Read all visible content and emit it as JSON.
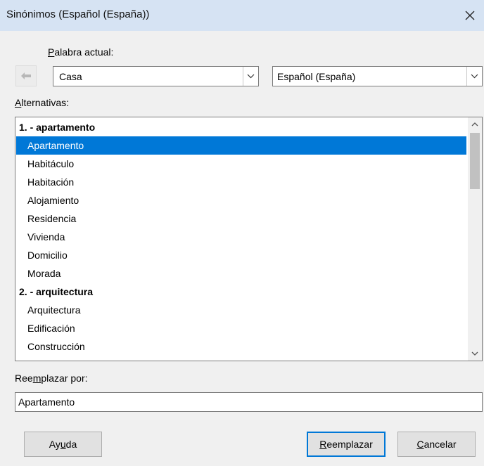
{
  "window": {
    "title": "Sinónimos (Español (España))"
  },
  "current_word": {
    "label_pre": "",
    "label_mnemonic": "P",
    "label_post": "alabra actual:",
    "value": "Casa"
  },
  "language": {
    "value": "Español (España)"
  },
  "alternatives": {
    "label_pre": "",
    "label_mnemonic": "A",
    "label_post": "lternativas:",
    "rows": [
      {
        "text": "1. - apartamento",
        "type": "header"
      },
      {
        "text": "Apartamento",
        "type": "item",
        "selected": true
      },
      {
        "text": "Habitáculo",
        "type": "item"
      },
      {
        "text": "Habitación",
        "type": "item"
      },
      {
        "text": "Alojamiento",
        "type": "item"
      },
      {
        "text": "Residencia",
        "type": "item"
      },
      {
        "text": "Vivienda",
        "type": "item"
      },
      {
        "text": "Domicilio",
        "type": "item"
      },
      {
        "text": "Morada",
        "type": "item"
      },
      {
        "text": "2. - arquitectura",
        "type": "header"
      },
      {
        "text": "Arquitectura",
        "type": "item"
      },
      {
        "text": "Edificación",
        "type": "item"
      },
      {
        "text": "Construcción",
        "type": "item"
      }
    ]
  },
  "replace_with": {
    "label_pre": "Ree",
    "label_mnemonic": "m",
    "label_post": "plazar por:",
    "value": "Apartamento"
  },
  "buttons": {
    "help": {
      "pre": "Ay",
      "mnemonic": "u",
      "post": "da"
    },
    "replace": {
      "pre": "",
      "mnemonic": "R",
      "post": "eemplazar"
    },
    "cancel": {
      "pre": "",
      "mnemonic": "C",
      "post": "ancelar"
    }
  },
  "icons": {
    "close": "close-icon",
    "back": "arrow-left-icon",
    "dropdown": "chevron-down-icon",
    "scroll_up": "chevron-up-icon",
    "scroll_down": "chevron-down-icon"
  },
  "colors": {
    "selection": "#0078d7",
    "titlebar": "#d6e3f3"
  }
}
